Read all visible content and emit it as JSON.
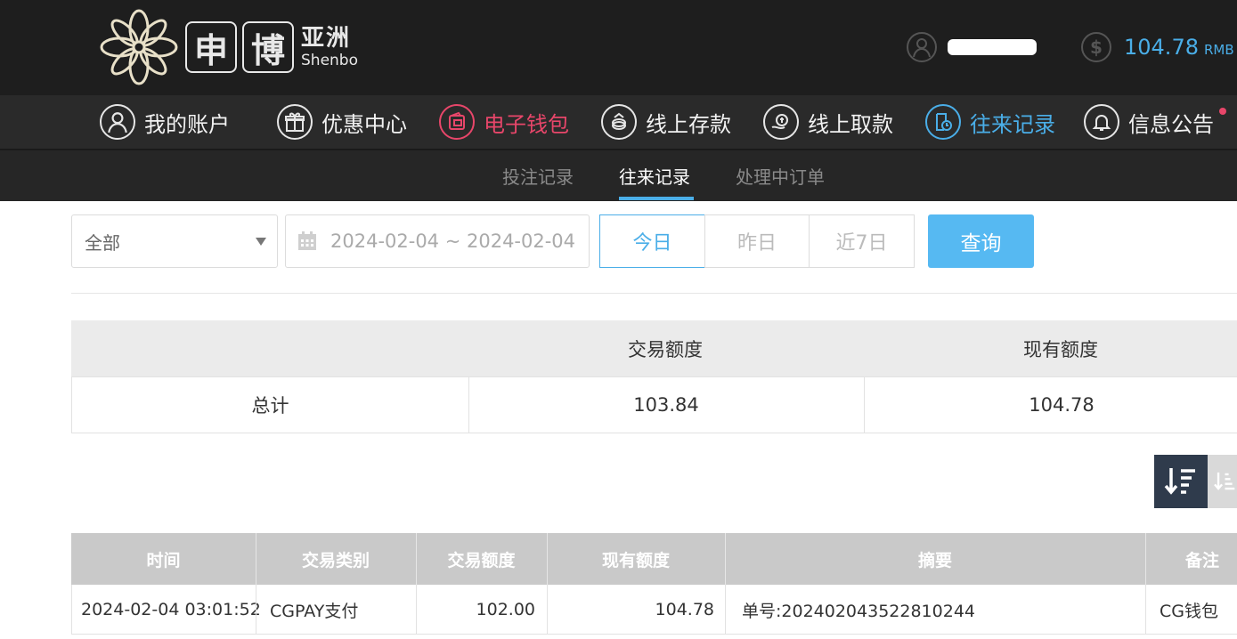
{
  "brand": {
    "box1": "申",
    "box2": "博",
    "cn": "亚洲",
    "en": "Shenbo"
  },
  "account": {
    "balance": "104.78",
    "unit": "RMB"
  },
  "main_nav": [
    {
      "label": "我的账户",
      "icon": "user-icon"
    },
    {
      "label": "优惠中心",
      "icon": "gift-icon"
    },
    {
      "label": "电子钱包",
      "icon": "wallet-icon"
    },
    {
      "label": "线上存款",
      "icon": "deposit-icon"
    },
    {
      "label": "线上取款",
      "icon": "withdraw-icon"
    },
    {
      "label": "往来记录",
      "icon": "records-icon"
    },
    {
      "label": "信息公告",
      "icon": "bell-icon"
    }
  ],
  "sub_nav": [
    {
      "label": "投注记录"
    },
    {
      "label": "往来记录"
    },
    {
      "label": "处理中订单"
    }
  ],
  "filters": {
    "type_selected": "全部",
    "date_range": "2024-02-04 ~ 2024-02-04",
    "quick": [
      "今日",
      "昨日",
      "近7日"
    ],
    "query_label": "查询"
  },
  "summary": {
    "headers": [
      "",
      "交易额度",
      "现有额度"
    ],
    "row": {
      "label": "总计",
      "trade": "103.84",
      "current": "104.78"
    }
  },
  "records": {
    "headers": [
      "时间",
      "交易类别",
      "交易额度",
      "现有额度",
      "摘要",
      "备注"
    ],
    "rows": [
      {
        "time": "2024-02-04 03:01:52",
        "type": "CGPAY支付",
        "trade": "102.00",
        "current": "104.78",
        "summary": "单号:202402043522810244",
        "note": "CG钱包"
      }
    ]
  },
  "colors": {
    "accent_blue": "#4aaee8",
    "accent_pink": "#e8466a",
    "header_bg": "#1e1e1e"
  }
}
